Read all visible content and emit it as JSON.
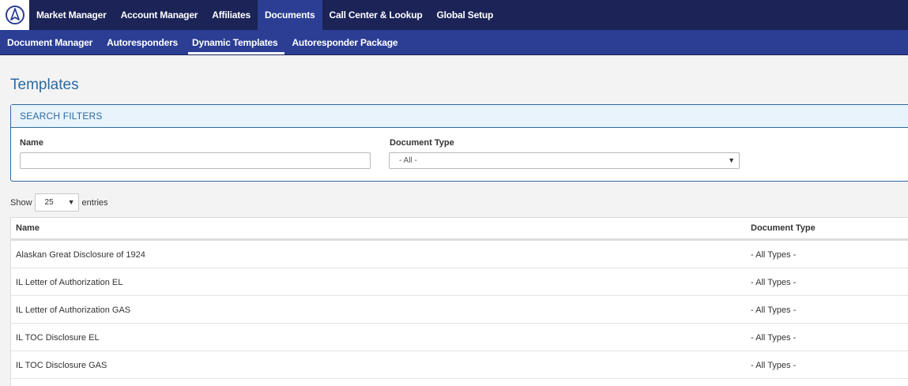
{
  "topnav": {
    "items": [
      {
        "label": "Market Manager",
        "active": false
      },
      {
        "label": "Account Manager",
        "active": false
      },
      {
        "label": "Affiliates",
        "active": false
      },
      {
        "label": "Documents",
        "active": true
      },
      {
        "label": "Call Center & Lookup",
        "active": false
      },
      {
        "label": "Global Setup",
        "active": false
      }
    ]
  },
  "subnav": {
    "items": [
      {
        "label": "Document Manager",
        "active": false
      },
      {
        "label": "Autoresponders",
        "active": false
      },
      {
        "label": "Dynamic Templates",
        "active": true
      },
      {
        "label": "Autoresponder Package",
        "active": false
      }
    ]
  },
  "page": {
    "title": "Templates"
  },
  "filters": {
    "header": "SEARCH FILTERS",
    "name_label": "Name",
    "name_value": "",
    "doc_type_label": "Document Type",
    "doc_type_value": "- All -"
  },
  "length_menu": {
    "show_label": "Show",
    "value": "25",
    "entries_label": "entries"
  },
  "table": {
    "columns": [
      "Name",
      "Document Type"
    ],
    "rows": [
      {
        "name": "Alaskan Great Disclosure of 1924",
        "type": "- All Types -"
      },
      {
        "name": "IL Letter of Authorization EL",
        "type": "- All Types -"
      },
      {
        "name": "IL Letter of Authorization GAS",
        "type": "- All Types -"
      },
      {
        "name": "IL TOC Disclosure EL",
        "type": "- All Types -"
      },
      {
        "name": "IL TOC Disclosure GAS",
        "type": "- All Types -"
      }
    ]
  },
  "colors": {
    "topnav_bg": "#1b2357",
    "subnav_bg": "#2b3e94",
    "accent": "#2d6a9f"
  }
}
